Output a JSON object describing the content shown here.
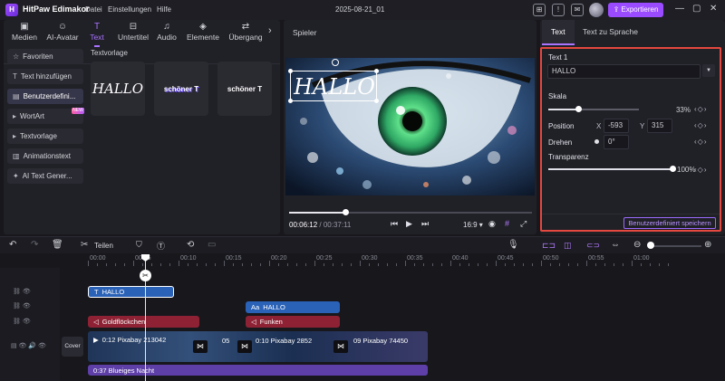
{
  "app": {
    "name": "HitPaw Edimakor",
    "menu": [
      "Datei",
      "Einstellungen",
      "Hilfe"
    ],
    "doc_title": "2025-08-21_01",
    "export_label": "Exportieren"
  },
  "media_tabs": [
    {
      "label": "Medien",
      "icon": "image-icon"
    },
    {
      "label": "AI-Avatar",
      "icon": "avatar-icon"
    },
    {
      "label": "Text",
      "icon": "text-icon"
    },
    {
      "label": "Untertitel",
      "icon": "subtitle-icon"
    },
    {
      "label": "Audio",
      "icon": "music-icon"
    },
    {
      "label": "Elemente",
      "icon": "elements-icon"
    },
    {
      "label": "Übergang",
      "icon": "transition-icon"
    }
  ],
  "sidebar": {
    "items": [
      {
        "label": "Favoriten"
      },
      {
        "label": "Text hinzufügen"
      },
      {
        "label": "Benutzerdefini..."
      },
      {
        "label": "WortArt",
        "badge": "NEW"
      },
      {
        "label": "Textvorlage"
      },
      {
        "label": "Animationstext"
      },
      {
        "label": "AI Text Gener..."
      }
    ]
  },
  "text_templates": {
    "section_label": "Textvorlage",
    "items": [
      "HALLO",
      "schöner T",
      "schöner T"
    ]
  },
  "player": {
    "title": "Spieler",
    "overlay_text": "HALLO",
    "current_time": "00:06:12",
    "total_time": "00:37:11",
    "aspect": "16:9",
    "progress": 0.23
  },
  "properties": {
    "tabs": [
      "Text",
      "Text zu Sprache"
    ],
    "section_title": "Text 1",
    "text_value": "HALLO",
    "scale_label": "Skala",
    "scale_value": "33%",
    "scale_fraction": 0.33,
    "position_label": "Position",
    "pos_x_label": "X",
    "pos_x_value": "-593",
    "pos_y_label": "Y",
    "pos_y_value": "315",
    "rotate_label": "Drehen",
    "rotate_value": "0°",
    "transparency_label": "Transparenz",
    "transparency_value": "100%",
    "transparency_fraction": 1.0,
    "save_label": "Benutzerdefiniert speichern"
  },
  "timeline": {
    "split_label": "Teilen",
    "ruler": [
      "00:00",
      "00:05",
      "00:10",
      "00:15",
      "00:20",
      "00:25",
      "00:30",
      "00:35",
      "00:40",
      "00:45",
      "00:50",
      "00:55",
      "01:00"
    ],
    "cover_label": "Cover",
    "clips": {
      "text1": "HALLO",
      "text2": "HALLO",
      "fx1": "Goldflöckchen",
      "fx2": "Funken",
      "video1": "0:12 Pixabay 213042",
      "video2": "05",
      "video3": "0:10 Pixabay 2852",
      "video4": "09 Pixabay 74450",
      "audio": "0:37 Blueiges Nacht"
    }
  }
}
